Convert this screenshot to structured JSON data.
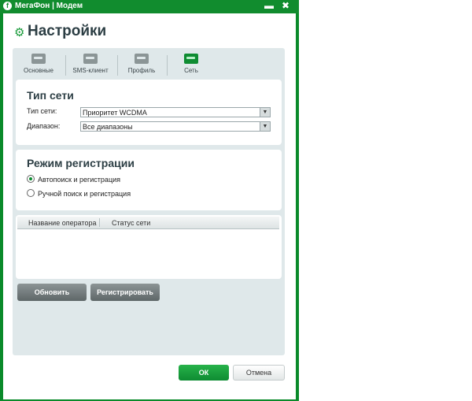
{
  "window": {
    "title": "МегаФон | Модем",
    "logo_glyph": "f"
  },
  "titlebar_buttons": {
    "minimize": "▬",
    "close": "✖"
  },
  "page": {
    "title": "Настройки",
    "gear_glyph": "⚙"
  },
  "tabs": [
    {
      "label": "Основные",
      "icon": "key-icon",
      "active": false
    },
    {
      "label": "SMS-клиент",
      "icon": "sms-icon",
      "active": false
    },
    {
      "label": "Профиль",
      "icon": "profile-icon",
      "active": false
    },
    {
      "label": "Сеть",
      "icon": "network-icon",
      "active": true
    }
  ],
  "network_type": {
    "heading": "Тип сети",
    "type_label": "Тип сети:",
    "type_value": "Приоритет WCDMA",
    "range_label": "Диапазон:",
    "range_value": "Все диапазоны"
  },
  "registration": {
    "heading": "Режим регистрации",
    "options": [
      {
        "label": "Автопоиск и регистрация",
        "selected": true
      },
      {
        "label": "Ручной поиск и регистрация",
        "selected": false
      }
    ]
  },
  "operators_table": {
    "columns": [
      "Название оператора",
      "Статус сети"
    ],
    "rows": []
  },
  "actions": {
    "refresh": "Обновить",
    "register": "Регистрировать"
  },
  "dialog": {
    "ok": "ОК",
    "cancel": "Отмена"
  },
  "colors": {
    "brand": "#118c2e",
    "accent": "#0e8c32",
    "panel": "#dfe8ea"
  }
}
